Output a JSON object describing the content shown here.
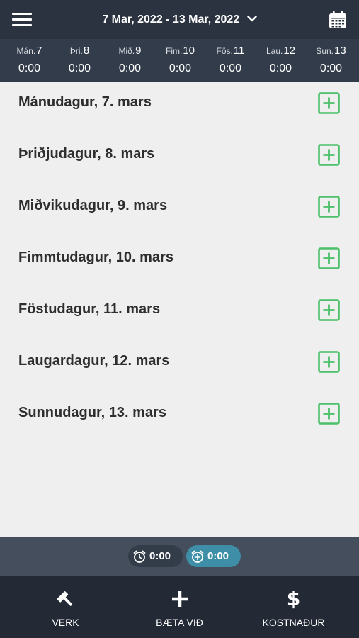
{
  "header": {
    "date_range": "7 Mar, 2022 - 13 Mar, 2022",
    "menu_icon": "hamburger-menu-icon",
    "calendar_icon": "calendar-icon"
  },
  "week": [
    {
      "name": "Mán.",
      "num": "7",
      "hours": "0:00"
    },
    {
      "name": "Þri.",
      "num": "8",
      "hours": "0:00"
    },
    {
      "name": "Mið.",
      "num": "9",
      "hours": "0:00"
    },
    {
      "name": "Fim.",
      "num": "10",
      "hours": "0:00"
    },
    {
      "name": "Fös.",
      "num": "11",
      "hours": "0:00"
    },
    {
      "name": "Lau.",
      "num": "12",
      "hours": "0:00"
    },
    {
      "name": "Sun.",
      "num": "13",
      "hours": "0:00"
    }
  ],
  "days": [
    {
      "label": "Mánudagur, 7. mars"
    },
    {
      "label": "Þriðjudagur, 8. mars"
    },
    {
      "label": "Miðvikudagur, 9. mars"
    },
    {
      "label": "Fimmtudagur, 10. mars"
    },
    {
      "label": "Föstudagur, 11. mars"
    },
    {
      "label": "Laugardagur, 12. mars"
    },
    {
      "label": "Sunnudagur, 13. mars"
    }
  ],
  "totals": {
    "total_time": "0:00",
    "added_time": "0:00"
  },
  "tabs": {
    "verk": "VERK",
    "add": "BÆTA VIÐ",
    "cost": "KOSTNAÐUR",
    "cost_symbol": "$"
  },
  "colors": {
    "header_bg": "#2b3340",
    "weekbar_bg": "#333c4a",
    "add_green": "#4cc06a",
    "accent_teal": "#3d8ea6",
    "tabbar_bg": "#232a36"
  }
}
